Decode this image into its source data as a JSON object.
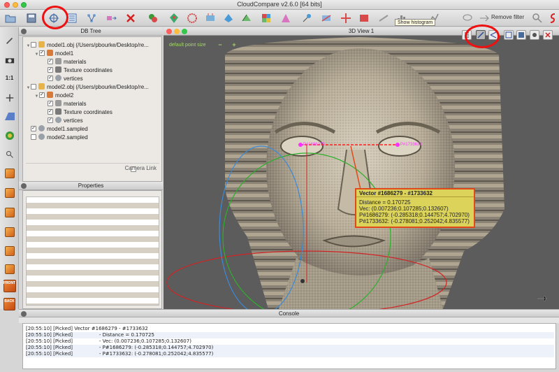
{
  "window": {
    "title": "CloudCompare v2.6.0 [64 bits]"
  },
  "toolbar": {
    "remove_filter": "Remove filter",
    "tooltip": "Show histogram"
  },
  "db_tree": {
    "title": "DB Tree",
    "rows": [
      {
        "label": "model1.obj (/Users/pbourke/Desktop/re...",
        "level": 0,
        "tri": "▼",
        "checked": false,
        "icon": "folder-icon"
      },
      {
        "label": "model1",
        "level": 1,
        "tri": "▼",
        "checked": true,
        "icon": "mesh-icon"
      },
      {
        "label": "materials",
        "level": 2,
        "tri": "",
        "checked": true,
        "icon": "materials-icon"
      },
      {
        "label": "Texture coordinates",
        "level": 2,
        "tri": "",
        "checked": true,
        "icon": "texture-coords-icon"
      },
      {
        "label": "vertices",
        "level": 2,
        "tri": "",
        "checked": true,
        "icon": "cloud-icon"
      },
      {
        "label": "model2.obj (/Users/pbourke/Desktop/re...",
        "level": 0,
        "tri": "▼",
        "checked": false,
        "icon": "folder-icon"
      },
      {
        "label": "model2",
        "level": 1,
        "tri": "▼",
        "checked": true,
        "icon": "mesh-icon"
      },
      {
        "label": "materials",
        "level": 2,
        "tri": "",
        "checked": true,
        "icon": "materials-icon"
      },
      {
        "label": "Texture coordinates",
        "level": 2,
        "tri": "",
        "checked": true,
        "icon": "texture-coords-icon"
      },
      {
        "label": "vertices",
        "level": 2,
        "tri": "",
        "checked": true,
        "icon": "cloud-icon"
      },
      {
        "label": "model1.sampled",
        "level": 0,
        "tri": "",
        "checked": true,
        "icon": "cloud-icon"
      },
      {
        "label": "model2.sampled",
        "level": 0,
        "tri": "",
        "checked": false,
        "icon": "cloud-icon"
      }
    ],
    "camera_link": "Camera Link"
  },
  "properties": {
    "title": "Properties"
  },
  "view3d": {
    "title": "3D View 1",
    "point_size_label": "default point size",
    "minus": "−",
    "plus": "+",
    "pick_label_a": "P#1686279",
    "pick_label_b": "P#1733632"
  },
  "measurement_label": {
    "title": "Vector #1686279 - #1733632",
    "lines": [
      "Distance = 0.170725",
      "Vec: (0.007236;0.107285;0.132607)",
      "P#1686279: (-0.285318;0.144757;4.702970)",
      "P#1733632: (-0.278081;0.252042;4.835577)"
    ]
  },
  "console": {
    "title": "Console",
    "lines": [
      "[20:55:10] [Picked] Vector #1686279 - #1733632",
      "[20:55:10] [Picked]                 - Distance = 0.170725",
      "[20:55:10] [Picked]                 - Vec: (0.007236;0.107285;0.132607)",
      "[20:55:10] [Picked]                 - P#1686279: (-0.285318;0.144757;4.702970)",
      "[20:55:10] [Picked]                 - P#1733632: (-0.278081;0.252042;4.835577)"
    ]
  },
  "left_toolbar": {
    "front_label": "FRONT",
    "back_label": "BACK",
    "zoom_label": "1:1"
  },
  "colors": {
    "highlight_circle": "#ee1111",
    "label_bg": "#dcd35a",
    "label_border": "#e04a1a",
    "pick_marker": "#ff30ff",
    "view_bg": "#5c5c5c"
  }
}
